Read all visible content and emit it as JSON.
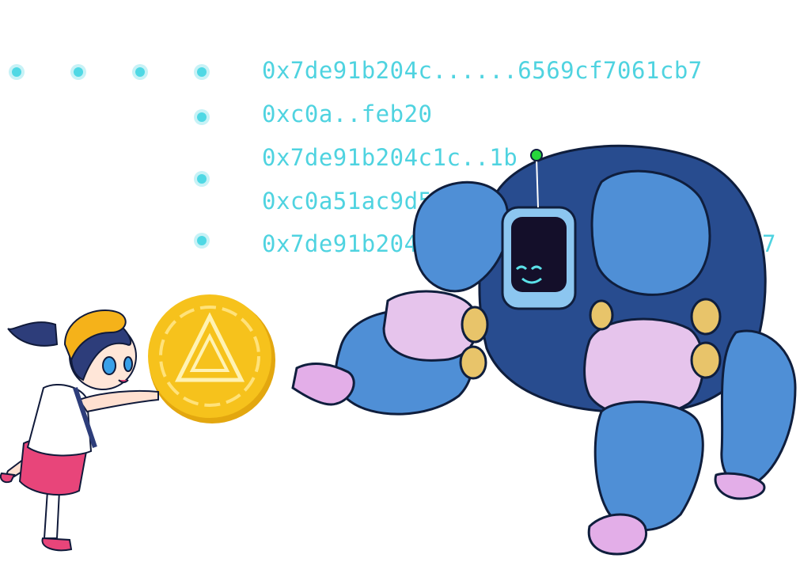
{
  "hashes": [
    "0x7de91b204c......6569cf7061cb7",
    "0xc0a..feb20",
    "0x7de91b204c1c..1b",
    "0xc0a51ac9d5",
    "0x7de91b204",
    "b7"
  ],
  "colors": {
    "accent": "#4fd3e0",
    "coin": "#f6c21c",
    "robot_dark": "#284c8f",
    "robot_light": "#4f8fd6",
    "robot_pink": "#e6c4ec",
    "girl_skirt": "#e8457a",
    "helmet": "#f5b21a"
  },
  "icons": [
    "coin-triangle-icon"
  ]
}
